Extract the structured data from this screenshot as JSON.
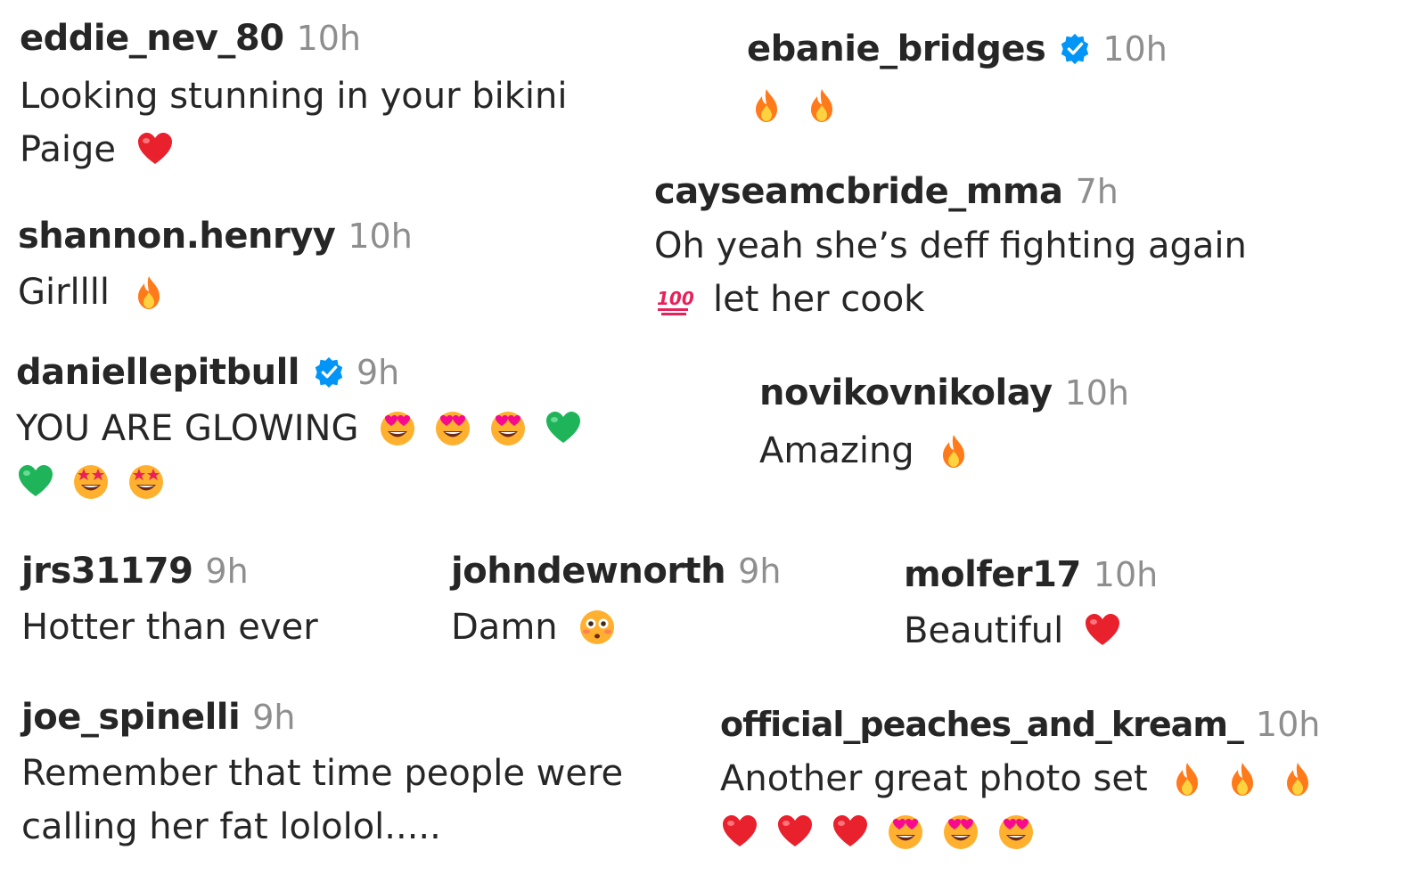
{
  "comments": [
    {
      "user": "eddie_nev_80",
      "time": "10h",
      "verified": false,
      "lines": [
        {
          "text": "Looking stunning in your bikini",
          "emojis": []
        },
        {
          "text": "Paige",
          "emojis": [
            "heart"
          ]
        }
      ]
    },
    {
      "user": "ebanie_bridges",
      "time": "10h",
      "verified": true,
      "lines": [
        {
          "text": "",
          "emojis": [
            "fire",
            "fire"
          ]
        }
      ]
    },
    {
      "user": "shannon.henryy",
      "time": "10h",
      "verified": false,
      "lines": [
        {
          "text": "Girllll",
          "emojis": [
            "fire"
          ]
        }
      ]
    },
    {
      "user": "cayseamcbride_mma",
      "time": "7h",
      "verified": false,
      "lines": [
        {
          "text": "Oh yeah she’s deff fighting again",
          "emojis": []
        },
        {
          "text": "let her cook",
          "emojis": [
            "hundred"
          ],
          "emoji_first": true
        }
      ]
    },
    {
      "user": "daniellepitbull",
      "time": "9h",
      "verified": true,
      "lines": [
        {
          "text": "YOU ARE GLOWING",
          "emojis": [
            "heart-eyes",
            "heart-eyes",
            "heart-eyes",
            "green-heart"
          ]
        },
        {
          "text": "",
          "emojis": [
            "green-heart",
            "star-struck",
            "star-struck"
          ]
        }
      ]
    },
    {
      "user": "novikovnikolay",
      "time": "10h",
      "verified": false,
      "lines": [
        {
          "text": "Amazing",
          "emojis": [
            "fire"
          ]
        }
      ]
    },
    {
      "user": "jrs31179",
      "time": "9h",
      "verified": false,
      "lines": [
        {
          "text": "Hotter than ever",
          "emojis": []
        }
      ]
    },
    {
      "user": "johndewnorth",
      "time": "9h",
      "verified": false,
      "lines": [
        {
          "text": "Damn",
          "emojis": [
            "flushed"
          ]
        }
      ]
    },
    {
      "user": "molfer17",
      "time": "10h",
      "verified": false,
      "lines": [
        {
          "text": "Beautiful",
          "emojis": [
            "heart"
          ]
        }
      ]
    },
    {
      "user": "joe_spinelli",
      "time": "9h",
      "verified": false,
      "lines": [
        {
          "text": "Remember that time people were",
          "emojis": []
        },
        {
          "text": "calling her fat lololol.....",
          "emojis": []
        }
      ]
    },
    {
      "user": "official_peaches_and_kream_",
      "time": "10h",
      "verified": false,
      "lines": [
        {
          "text": "Another great photo set",
          "emojis": [
            "fire",
            "fire",
            "fire"
          ]
        },
        {
          "text": "",
          "emojis": [
            "heart",
            "heart",
            "heart",
            "heart-eyes",
            "heart-eyes",
            "heart-eyes"
          ]
        }
      ]
    }
  ],
  "colors": {
    "username": "#262626",
    "timestamp": "#8e8e8e",
    "verified_badge": "#0095f6",
    "heart": "#e8212d",
    "green_heart": "#1fb45a",
    "fire": "#ff7a1a",
    "hundred": "#e8215a",
    "emoji_face": "#ffb02e"
  }
}
